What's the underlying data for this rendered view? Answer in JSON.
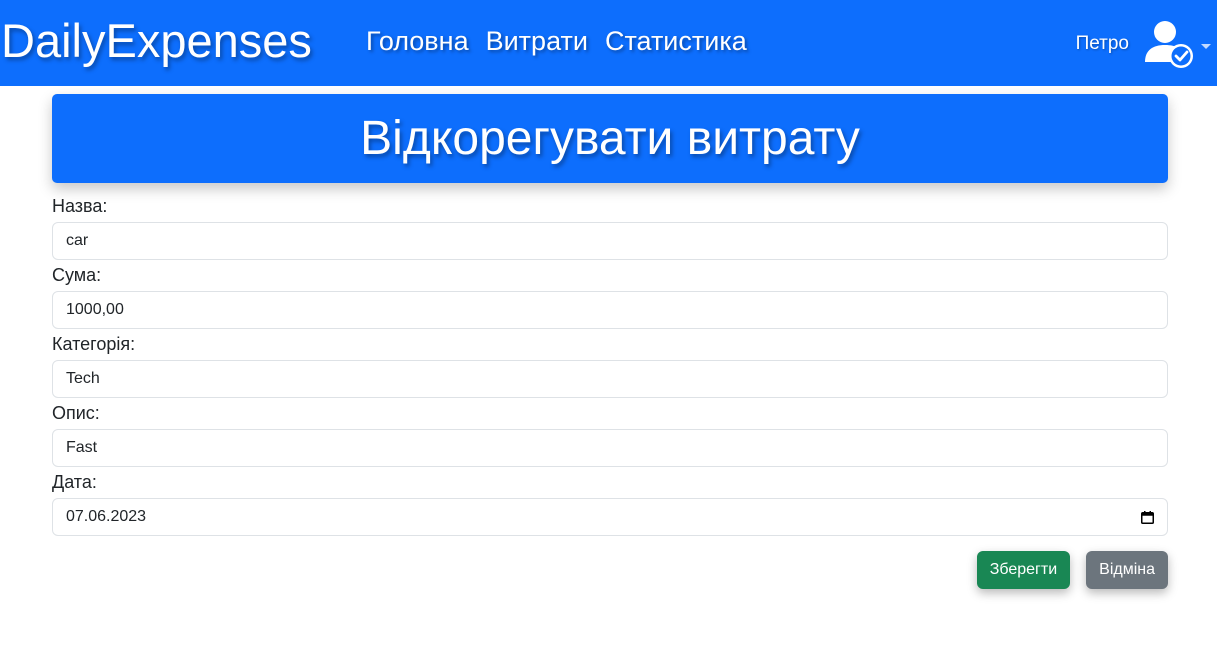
{
  "navbar": {
    "brand": "DailyExpenses",
    "links": [
      "Головна",
      "Витрати",
      "Статистика"
    ],
    "user_name": "Петро",
    "avatar_icon": "user-check-icon",
    "colors": {
      "primary": "#0d6efd"
    }
  },
  "header": {
    "title": "Відкорегувати витрату"
  },
  "form": {
    "fields": [
      {
        "label": "Назва:",
        "value": "car"
      },
      {
        "label": "Сума:",
        "value": "1000,00"
      },
      {
        "label": "Категорія:",
        "value": "Tech"
      },
      {
        "label": "Опис:",
        "value": "Fast"
      },
      {
        "label": "Дата:",
        "value": "07.06.2023"
      }
    ]
  },
  "actions": {
    "save_label": "Зберегти",
    "cancel_label": "Відміна",
    "colors": {
      "save": "#198754",
      "cancel": "#6c757d"
    }
  }
}
